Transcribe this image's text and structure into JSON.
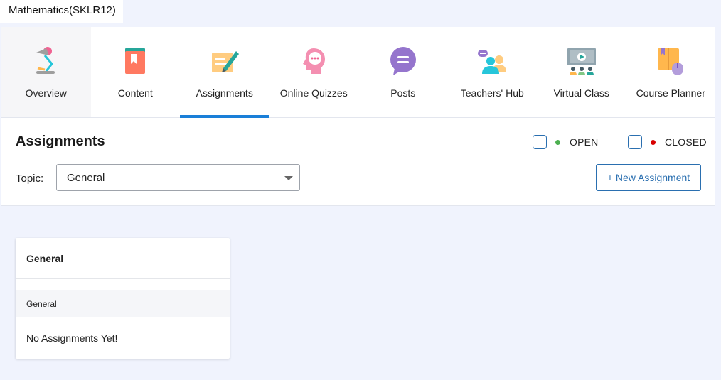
{
  "course": {
    "title": "Mathematics(SKLR12)"
  },
  "nav": {
    "items": [
      {
        "label": "Overview",
        "icon": "desk-lamp-icon"
      },
      {
        "label": "Content",
        "icon": "book-icon"
      },
      {
        "label": "Assignments",
        "icon": "pencil-paper-icon"
      },
      {
        "label": "Online Quizzes",
        "icon": "head-thought-icon"
      },
      {
        "label": "Posts",
        "icon": "chat-bubble-icon"
      },
      {
        "label": "Teachers' Hub",
        "icon": "teachers-group-icon"
      },
      {
        "label": "Virtual Class",
        "icon": "virtual-classroom-icon"
      },
      {
        "label": "Course Planner",
        "icon": "planner-icon"
      }
    ],
    "active_index": 2,
    "active_color": "#1a7fd8"
  },
  "header": {
    "title": "Assignments",
    "filters": {
      "open_label": "OPEN",
      "open_color": "#4caf50",
      "closed_label": "CLOSED",
      "closed_color": "#d80000"
    },
    "topic_label": "Topic:",
    "topic_value": "General",
    "new_button_label": "+ New Assignment"
  },
  "cards": [
    {
      "title": "General",
      "subheader": "General",
      "empty_text": "No Assignments Yet!"
    }
  ]
}
